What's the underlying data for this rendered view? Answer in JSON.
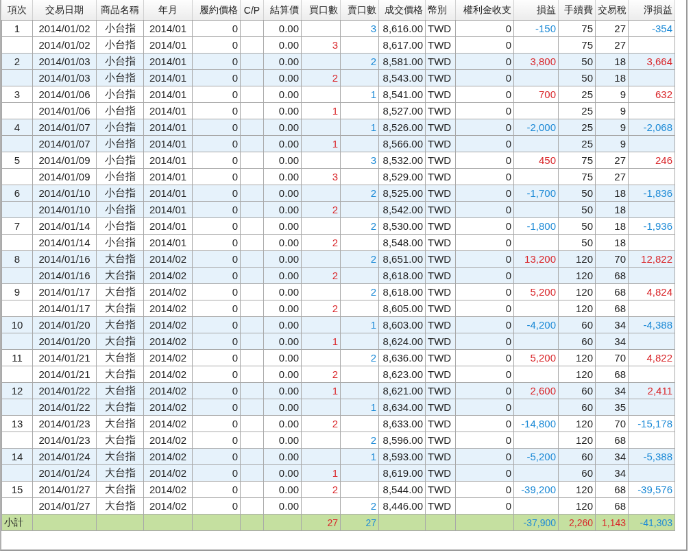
{
  "columns": [
    "項次",
    "交易日期",
    "商品名稱",
    "年月",
    "履約價格",
    "C/P",
    "結算價",
    "買口數",
    "賣口數",
    "成交價格",
    "幣別",
    "權利金收支",
    "損益",
    "手續費",
    "交易稅",
    "淨損益"
  ],
  "trades": [
    {
      "no": "1",
      "pnl": {
        "text": "-150",
        "color": "#1d8ad6"
      },
      "net": {
        "text": "-354",
        "color": "#1d8ad6"
      },
      "legs": [
        {
          "date": "2014/01/02",
          "product": "小台指",
          "month": "2014/01",
          "strike": "0",
          "settle": "0.00",
          "sell": "3",
          "price": "8,616.00",
          "currency": "TWD",
          "premium": "0",
          "fee": "75",
          "tax": "27"
        },
        {
          "date": "2014/01/02",
          "product": "小台指",
          "month": "2014/01",
          "strike": "0",
          "settle": "0.00",
          "buy": "3",
          "price": "8,617.00",
          "currency": "TWD",
          "premium": "0",
          "fee": "75",
          "tax": "27"
        }
      ]
    },
    {
      "no": "2",
      "pnl": {
        "text": "3,800",
        "color": "#d9262a"
      },
      "net": {
        "text": "3,664",
        "color": "#d9262a"
      },
      "legs": [
        {
          "date": "2014/01/03",
          "product": "小台指",
          "month": "2014/01",
          "strike": "0",
          "settle": "0.00",
          "sell": "2",
          "price": "8,581.00",
          "currency": "TWD",
          "premium": "0",
          "fee": "50",
          "tax": "18"
        },
        {
          "date": "2014/01/03",
          "product": "小台指",
          "month": "2014/01",
          "strike": "0",
          "settle": "0.00",
          "buy": "2",
          "price": "8,543.00",
          "currency": "TWD",
          "premium": "0",
          "fee": "50",
          "tax": "18"
        }
      ]
    },
    {
      "no": "3",
      "pnl": {
        "text": "700",
        "color": "#d9262a"
      },
      "net": {
        "text": "632",
        "color": "#d9262a"
      },
      "legs": [
        {
          "date": "2014/01/06",
          "product": "小台指",
          "month": "2014/01",
          "strike": "0",
          "settle": "0.00",
          "sell": "1",
          "price": "8,541.00",
          "currency": "TWD",
          "premium": "0",
          "fee": "25",
          "tax": "9"
        },
        {
          "date": "2014/01/06",
          "product": "小台指",
          "month": "2014/01",
          "strike": "0",
          "settle": "0.00",
          "buy": "1",
          "price": "8,527.00",
          "currency": "TWD",
          "premium": "0",
          "fee": "25",
          "tax": "9"
        }
      ]
    },
    {
      "no": "4",
      "pnl": {
        "text": "-2,000",
        "color": "#1d8ad6"
      },
      "net": {
        "text": "-2,068",
        "color": "#1d8ad6"
      },
      "legs": [
        {
          "date": "2014/01/07",
          "product": "小台指",
          "month": "2014/01",
          "strike": "0",
          "settle": "0.00",
          "sell": "1",
          "price": "8,526.00",
          "currency": "TWD",
          "premium": "0",
          "fee": "25",
          "tax": "9"
        },
        {
          "date": "2014/01/07",
          "product": "小台指",
          "month": "2014/01",
          "strike": "0",
          "settle": "0.00",
          "buy": "1",
          "price": "8,566.00",
          "currency": "TWD",
          "premium": "0",
          "fee": "25",
          "tax": "9"
        }
      ]
    },
    {
      "no": "5",
      "pnl": {
        "text": "450",
        "color": "#d9262a"
      },
      "net": {
        "text": "246",
        "color": "#d9262a"
      },
      "legs": [
        {
          "date": "2014/01/09",
          "product": "小台指",
          "month": "2014/01",
          "strike": "0",
          "settle": "0.00",
          "sell": "3",
          "price": "8,532.00",
          "currency": "TWD",
          "premium": "0",
          "fee": "75",
          "tax": "27"
        },
        {
          "date": "2014/01/09",
          "product": "小台指",
          "month": "2014/01",
          "strike": "0",
          "settle": "0.00",
          "buy": "3",
          "price": "8,529.00",
          "currency": "TWD",
          "premium": "0",
          "fee": "75",
          "tax": "27"
        }
      ]
    },
    {
      "no": "6",
      "pnl": {
        "text": "-1,700",
        "color": "#1d8ad6"
      },
      "net": {
        "text": "-1,836",
        "color": "#1d8ad6"
      },
      "legs": [
        {
          "date": "2014/01/10",
          "product": "小台指",
          "month": "2014/01",
          "strike": "0",
          "settle": "0.00",
          "sell": "2",
          "price": "8,525.00",
          "currency": "TWD",
          "premium": "0",
          "fee": "50",
          "tax": "18"
        },
        {
          "date": "2014/01/10",
          "product": "小台指",
          "month": "2014/01",
          "strike": "0",
          "settle": "0.00",
          "buy": "2",
          "price": "8,542.00",
          "currency": "TWD",
          "premium": "0",
          "fee": "50",
          "tax": "18"
        }
      ]
    },
    {
      "no": "7",
      "pnl": {
        "text": "-1,800",
        "color": "#1d8ad6"
      },
      "net": {
        "text": "-1,936",
        "color": "#1d8ad6"
      },
      "legs": [
        {
          "date": "2014/01/14",
          "product": "小台指",
          "month": "2014/01",
          "strike": "0",
          "settle": "0.00",
          "sell": "2",
          "price": "8,530.00",
          "currency": "TWD",
          "premium": "0",
          "fee": "50",
          "tax": "18"
        },
        {
          "date": "2014/01/14",
          "product": "小台指",
          "month": "2014/01",
          "strike": "0",
          "settle": "0.00",
          "buy": "2",
          "price": "8,548.00",
          "currency": "TWD",
          "premium": "0",
          "fee": "50",
          "tax": "18"
        }
      ]
    },
    {
      "no": "8",
      "pnl": {
        "text": "13,200",
        "color": "#d9262a"
      },
      "net": {
        "text": "12,822",
        "color": "#d9262a"
      },
      "legs": [
        {
          "date": "2014/01/16",
          "product": "大台指",
          "month": "2014/02",
          "strike": "0",
          "settle": "0.00",
          "sell": "2",
          "price": "8,651.00",
          "currency": "TWD",
          "premium": "0",
          "fee": "120",
          "tax": "70"
        },
        {
          "date": "2014/01/16",
          "product": "大台指",
          "month": "2014/02",
          "strike": "0",
          "settle": "0.00",
          "buy": "2",
          "price": "8,618.00",
          "currency": "TWD",
          "premium": "0",
          "fee": "120",
          "tax": "68"
        }
      ]
    },
    {
      "no": "9",
      "pnl": {
        "text": "5,200",
        "color": "#d9262a"
      },
      "net": {
        "text": "4,824",
        "color": "#d9262a"
      },
      "legs": [
        {
          "date": "2014/01/17",
          "product": "大台指",
          "month": "2014/02",
          "strike": "0",
          "settle": "0.00",
          "sell": "2",
          "price": "8,618.00",
          "currency": "TWD",
          "premium": "0",
          "fee": "120",
          "tax": "68"
        },
        {
          "date": "2014/01/17",
          "product": "大台指",
          "month": "2014/02",
          "strike": "0",
          "settle": "0.00",
          "buy": "2",
          "price": "8,605.00",
          "currency": "TWD",
          "premium": "0",
          "fee": "120",
          "tax": "68"
        }
      ]
    },
    {
      "no": "10",
      "pnl": {
        "text": "-4,200",
        "color": "#1d8ad6"
      },
      "net": {
        "text": "-4,388",
        "color": "#1d8ad6"
      },
      "legs": [
        {
          "date": "2014/01/20",
          "product": "大台指",
          "month": "2014/02",
          "strike": "0",
          "settle": "0.00",
          "sell": "1",
          "price": "8,603.00",
          "currency": "TWD",
          "premium": "0",
          "fee": "60",
          "tax": "34"
        },
        {
          "date": "2014/01/20",
          "product": "大台指",
          "month": "2014/02",
          "strike": "0",
          "settle": "0.00",
          "buy": "1",
          "price": "8,624.00",
          "currency": "TWD",
          "premium": "0",
          "fee": "60",
          "tax": "34"
        }
      ]
    },
    {
      "no": "11",
      "pnl": {
        "text": "5,200",
        "color": "#d9262a"
      },
      "net": {
        "text": "4,822",
        "color": "#d9262a"
      },
      "legs": [
        {
          "date": "2014/01/21",
          "product": "大台指",
          "month": "2014/02",
          "strike": "0",
          "settle": "0.00",
          "sell": "2",
          "price": "8,636.00",
          "currency": "TWD",
          "premium": "0",
          "fee": "120",
          "tax": "70"
        },
        {
          "date": "2014/01/21",
          "product": "大台指",
          "month": "2014/02",
          "strike": "0",
          "settle": "0.00",
          "buy": "2",
          "price": "8,623.00",
          "currency": "TWD",
          "premium": "0",
          "fee": "120",
          "tax": "68"
        }
      ]
    },
    {
      "no": "12",
      "pnl": {
        "text": "2,600",
        "color": "#d9262a"
      },
      "net": {
        "text": "2,411",
        "color": "#d9262a"
      },
      "legs": [
        {
          "date": "2014/01/22",
          "product": "大台指",
          "month": "2014/02",
          "strike": "0",
          "settle": "0.00",
          "buy": "1",
          "price": "8,621.00",
          "currency": "TWD",
          "premium": "0",
          "fee": "60",
          "tax": "34"
        },
        {
          "date": "2014/01/22",
          "product": "大台指",
          "month": "2014/02",
          "strike": "0",
          "settle": "0.00",
          "sell": "1",
          "price": "8,634.00",
          "currency": "TWD",
          "premium": "0",
          "fee": "60",
          "tax": "35"
        }
      ]
    },
    {
      "no": "13",
      "pnl": {
        "text": "-14,800",
        "color": "#1d8ad6"
      },
      "net": {
        "text": "-15,178",
        "color": "#1d8ad6"
      },
      "legs": [
        {
          "date": "2014/01/23",
          "product": "大台指",
          "month": "2014/02",
          "strike": "0",
          "settle": "0.00",
          "buy": "2",
          "price": "8,633.00",
          "currency": "TWD",
          "premium": "0",
          "fee": "120",
          "tax": "70"
        },
        {
          "date": "2014/01/23",
          "product": "大台指",
          "month": "2014/02",
          "strike": "0",
          "settle": "0.00",
          "sell": "2",
          "price": "8,596.00",
          "currency": "TWD",
          "premium": "0",
          "fee": "120",
          "tax": "68"
        }
      ]
    },
    {
      "no": "14",
      "pnl": {
        "text": "-5,200",
        "color": "#1d8ad6"
      },
      "net": {
        "text": "-5,388",
        "color": "#1d8ad6"
      },
      "legs": [
        {
          "date": "2014/01/24",
          "product": "大台指",
          "month": "2014/02",
          "strike": "0",
          "settle": "0.00",
          "sell": "1",
          "price": "8,593.00",
          "currency": "TWD",
          "premium": "0",
          "fee": "60",
          "tax": "34"
        },
        {
          "date": "2014/01/24",
          "product": "大台指",
          "month": "2014/02",
          "strike": "0",
          "settle": "0.00",
          "buy": "1",
          "price": "8,619.00",
          "currency": "TWD",
          "premium": "0",
          "fee": "60",
          "tax": "34"
        }
      ]
    },
    {
      "no": "15",
      "pnl": {
        "text": "-39,200",
        "color": "#1d8ad6"
      },
      "net": {
        "text": "-39,576",
        "color": "#1d8ad6"
      },
      "legs": [
        {
          "date": "2014/01/27",
          "product": "大台指",
          "month": "2014/02",
          "strike": "0",
          "settle": "0.00",
          "buy": "2",
          "price": "8,544.00",
          "currency": "TWD",
          "premium": "0",
          "fee": "120",
          "tax": "68"
        },
        {
          "date": "2014/01/27",
          "product": "大台指",
          "month": "2014/02",
          "strike": "0",
          "settle": "0.00",
          "sell": "2",
          "price": "8,446.00",
          "currency": "TWD",
          "premium": "0",
          "fee": "120",
          "tax": "68"
        }
      ]
    }
  ],
  "subtotal": {
    "label": "小計",
    "buy": "27",
    "sell": "27",
    "pnl": {
      "text": "-37,900",
      "color": "#1d8ad6"
    },
    "fee": {
      "text": "2,260",
      "color": "#d9262a"
    },
    "tax": {
      "text": "1,143",
      "color": "#d9262a"
    },
    "net": {
      "text": "-41,303",
      "color": "#1d8ad6"
    }
  }
}
